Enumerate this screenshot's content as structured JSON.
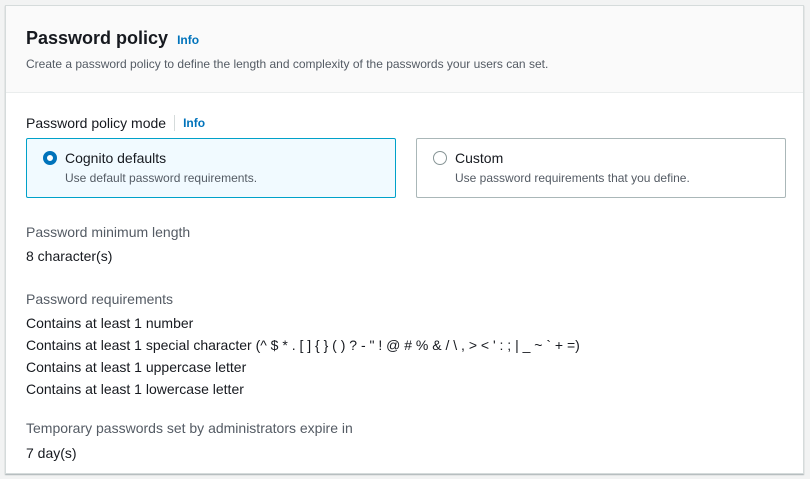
{
  "header": {
    "title": "Password policy",
    "info_label": "Info",
    "description": "Create a password policy to define the length and complexity of the passwords your users can set."
  },
  "mode": {
    "label": "Password policy mode",
    "info_label": "Info",
    "options": [
      {
        "title": "Cognito defaults",
        "description": "Use default password requirements.",
        "selected": true
      },
      {
        "title": "Custom",
        "description": "Use password requirements that you define.",
        "selected": false
      }
    ]
  },
  "min_length": {
    "label": "Password minimum length",
    "value": "8 character(s)"
  },
  "requirements": {
    "label": "Password requirements",
    "items": [
      "Contains at least 1 number",
      "Contains at least 1 special character (^ $ * . [ ] { } ( ) ? - \" ! @ # % & / \\ , > < ' : ; | _ ~ ` + =)",
      "Contains at least 1 uppercase letter",
      "Contains at least 1 lowercase letter"
    ]
  },
  "temporary": {
    "label": "Temporary passwords set by administrators expire in",
    "value": "7 day(s)"
  },
  "colors": {
    "link": "#0073bb",
    "selected_border": "#00a1c9",
    "selected_bg": "#f1faff"
  }
}
